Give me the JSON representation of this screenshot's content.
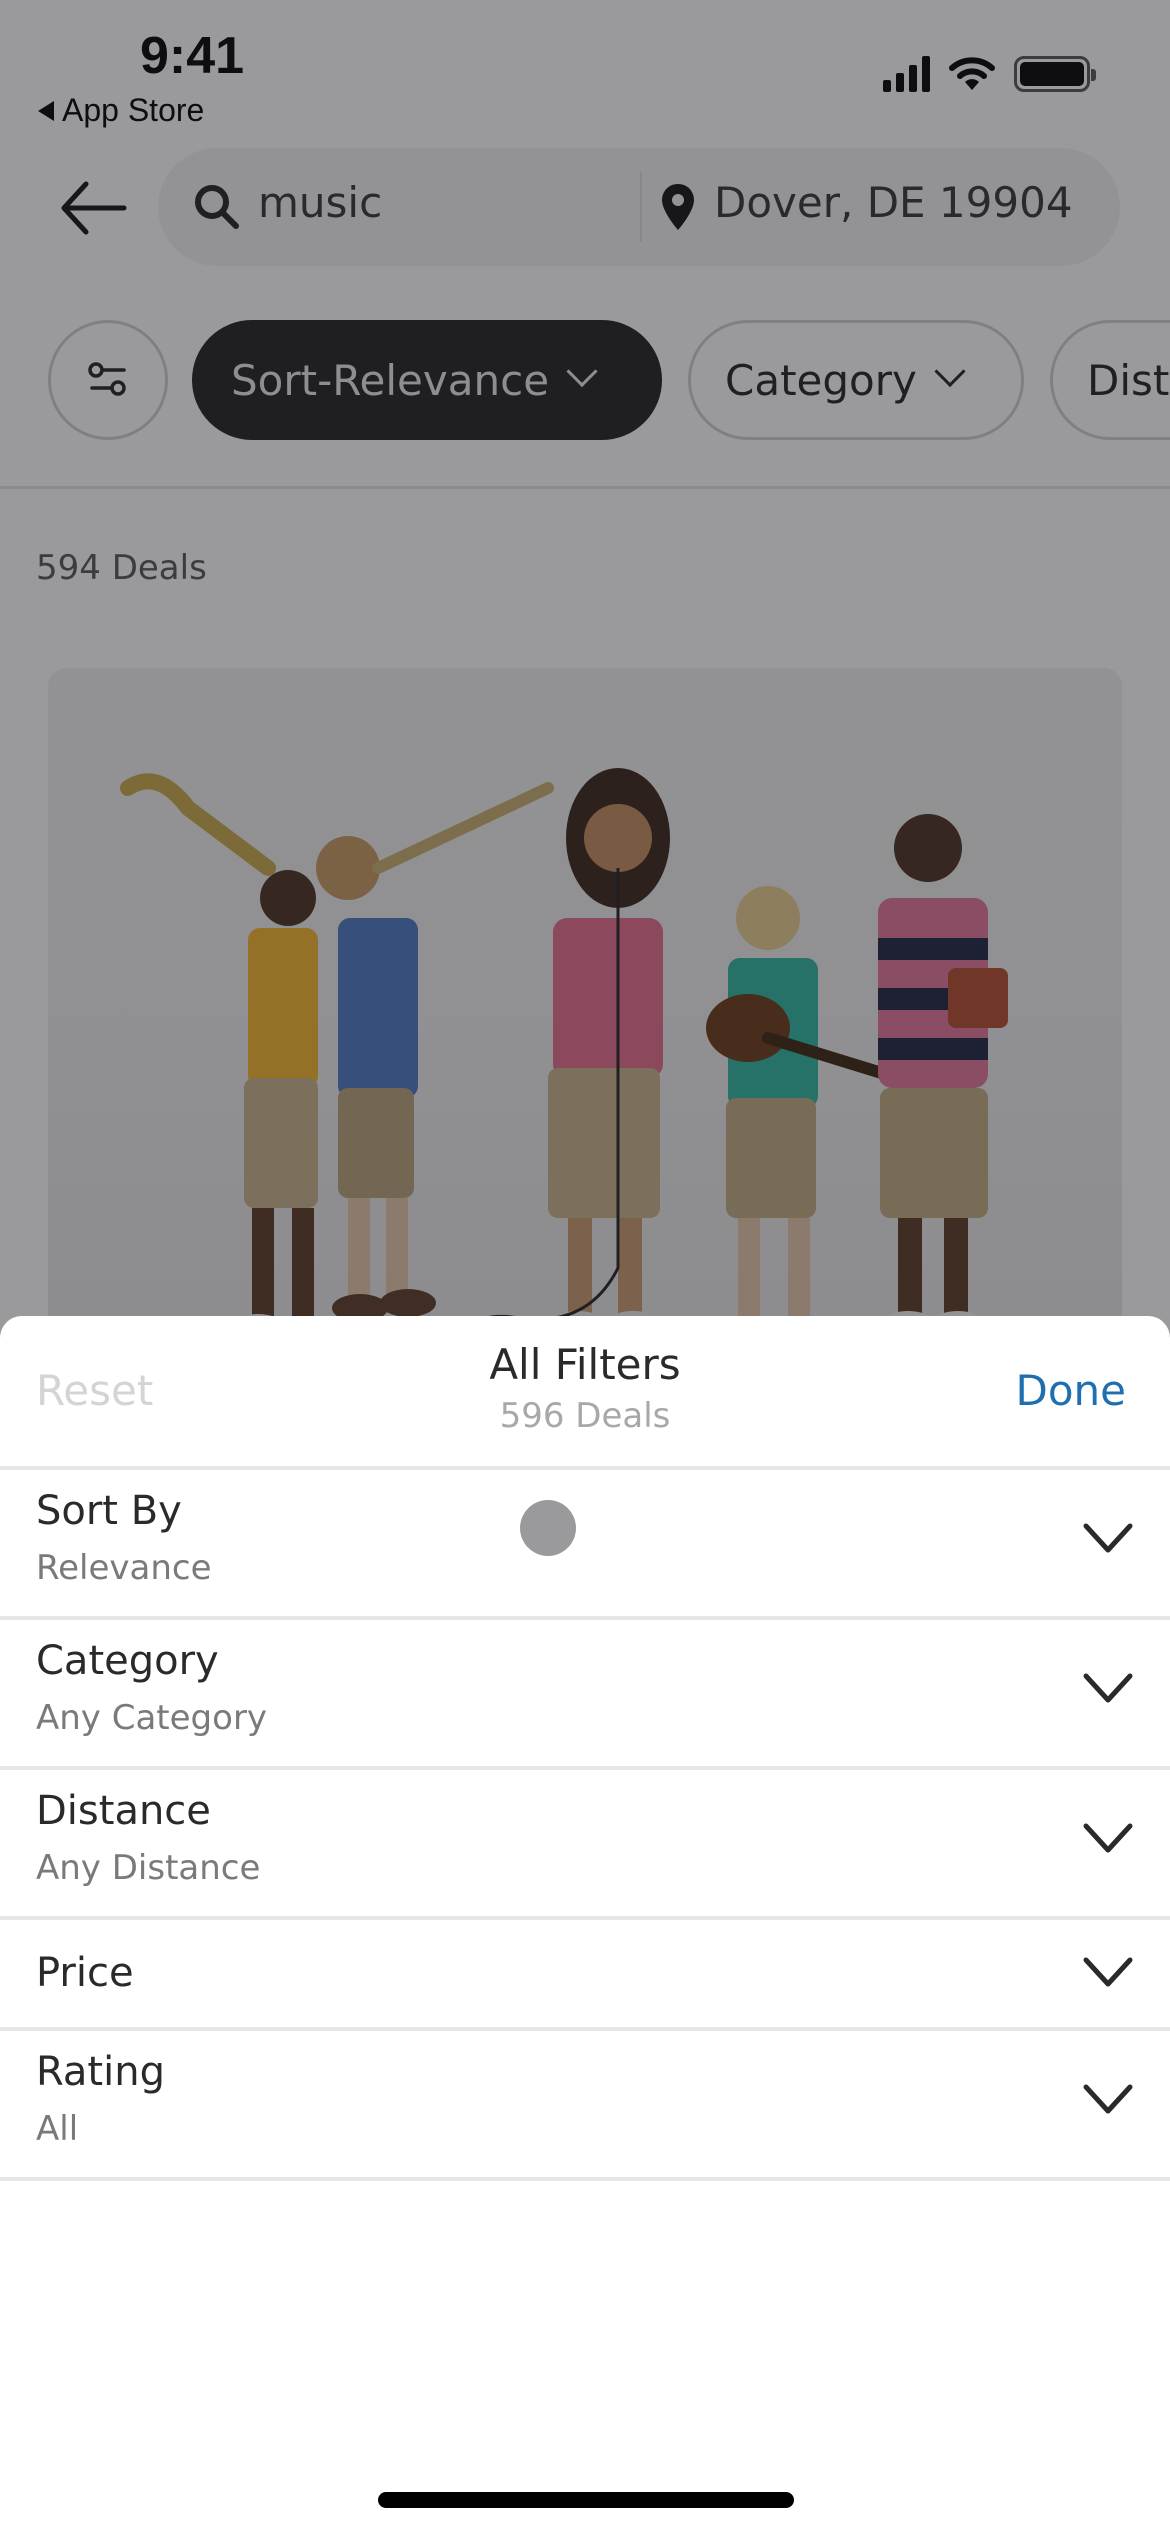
{
  "status_bar": {
    "time": "9:41",
    "back_app": "App Store",
    "icons": [
      "cellular-signal-icon",
      "wifi-icon",
      "battery-icon"
    ]
  },
  "search": {
    "query": "music",
    "location": "Dover, DE 19904",
    "icons": {
      "back": "arrow-left-icon",
      "search": "magnifier-icon",
      "location": "map-pin-icon"
    }
  },
  "chips": {
    "filter_icon": "sliders-icon",
    "sort": "Sort-Relevance",
    "category": "Category",
    "distance": "Dist"
  },
  "results": {
    "count_label": "594 Deals",
    "image_alt": "Children playing musical instruments"
  },
  "sheet": {
    "reset": "Reset",
    "title": "All Filters",
    "subtitle": "596 Deals",
    "done": "Done",
    "filters": [
      {
        "label": "Sort By",
        "value": "Relevance"
      },
      {
        "label": "Category",
        "value": "Any Category"
      },
      {
        "label": "Distance",
        "value": "Any Distance"
      },
      {
        "label": "Price",
        "value": ""
      },
      {
        "label": "Rating",
        "value": "All"
      }
    ]
  },
  "colors": {
    "accent": "#1f6fb0",
    "active_chip": "#1f1e22",
    "reset_disabled": "#d4d4d4"
  }
}
